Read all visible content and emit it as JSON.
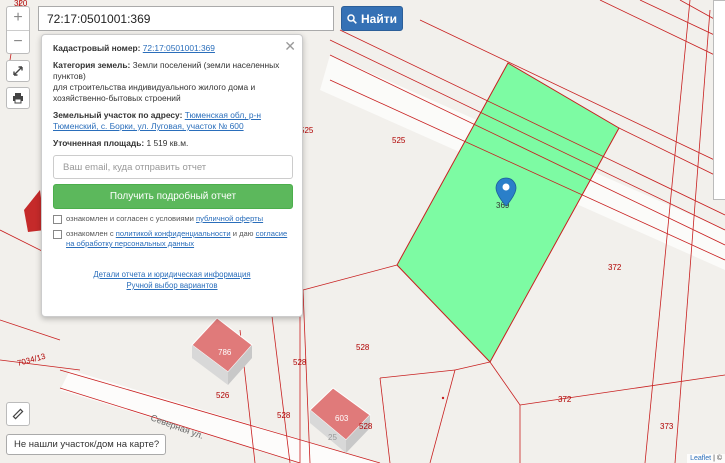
{
  "search": {
    "value": "72:17:0501001:369",
    "button_label": "Найти"
  },
  "popup": {
    "cad_label": "Кадастровый номер:",
    "cad_value": "72:17:0501001:369",
    "cat_label": "Категория земель:",
    "cat_value": "Земли поселений (земли населенных пунктов)",
    "cat_use": "для строительства индивидуального жилого дома и хозяйственно-бытовых строений",
    "addr_label": "Земельный участок по адресу:",
    "addr_value": "Тюменская обл, р-н Тюменский, с. Борки, ул. Луговая, участок № 600",
    "area_label": "Уточненная площадь:",
    "area_value": "1 519 кв.м.",
    "email_placeholder": "Ваш email, куда отправить отчет",
    "get_report": "Получить подробный отчет",
    "check1_text": "ознакомлен и согласен с условиями",
    "check1_link": "публичной оферты",
    "check2_text_a": "ознакомлен с",
    "check2_link_a": "политикой конфиденциальности",
    "check2_text_b": "и даю",
    "check2_link_b": "согласие на обработку персональных данных",
    "link_details": "Детали отчета и юридическая информация",
    "link_manual": "Ручной выбор вариантов"
  },
  "map_labels": {
    "l525": "525",
    "l525b": "525",
    "l372a": "372",
    "l372b": "372",
    "l373": "373",
    "l528a": "528",
    "l528b": "528",
    "l528c": "528",
    "l528d": "528",
    "l526": "526",
    "l786": "786",
    "l603": "603",
    "l369": "369",
    "l7034": "7034/13",
    "l320": "320",
    "l25": "25",
    "street": "Северная ул."
  },
  "not_found": "Не нашли участок/дом на карте?",
  "attribution": {
    "leaflet": "Leaflet",
    "rest": "| ©"
  },
  "colors": {
    "parcel": "#7dfba3",
    "boundary": "#c82020",
    "button": "#3571b5",
    "cta": "#5cb85c",
    "building": "#e07a7a"
  },
  "icons": [
    "search-icon",
    "fullscreen-icon",
    "print-icon",
    "ruler-icon",
    "map-marker-icon",
    "close-icon"
  ]
}
